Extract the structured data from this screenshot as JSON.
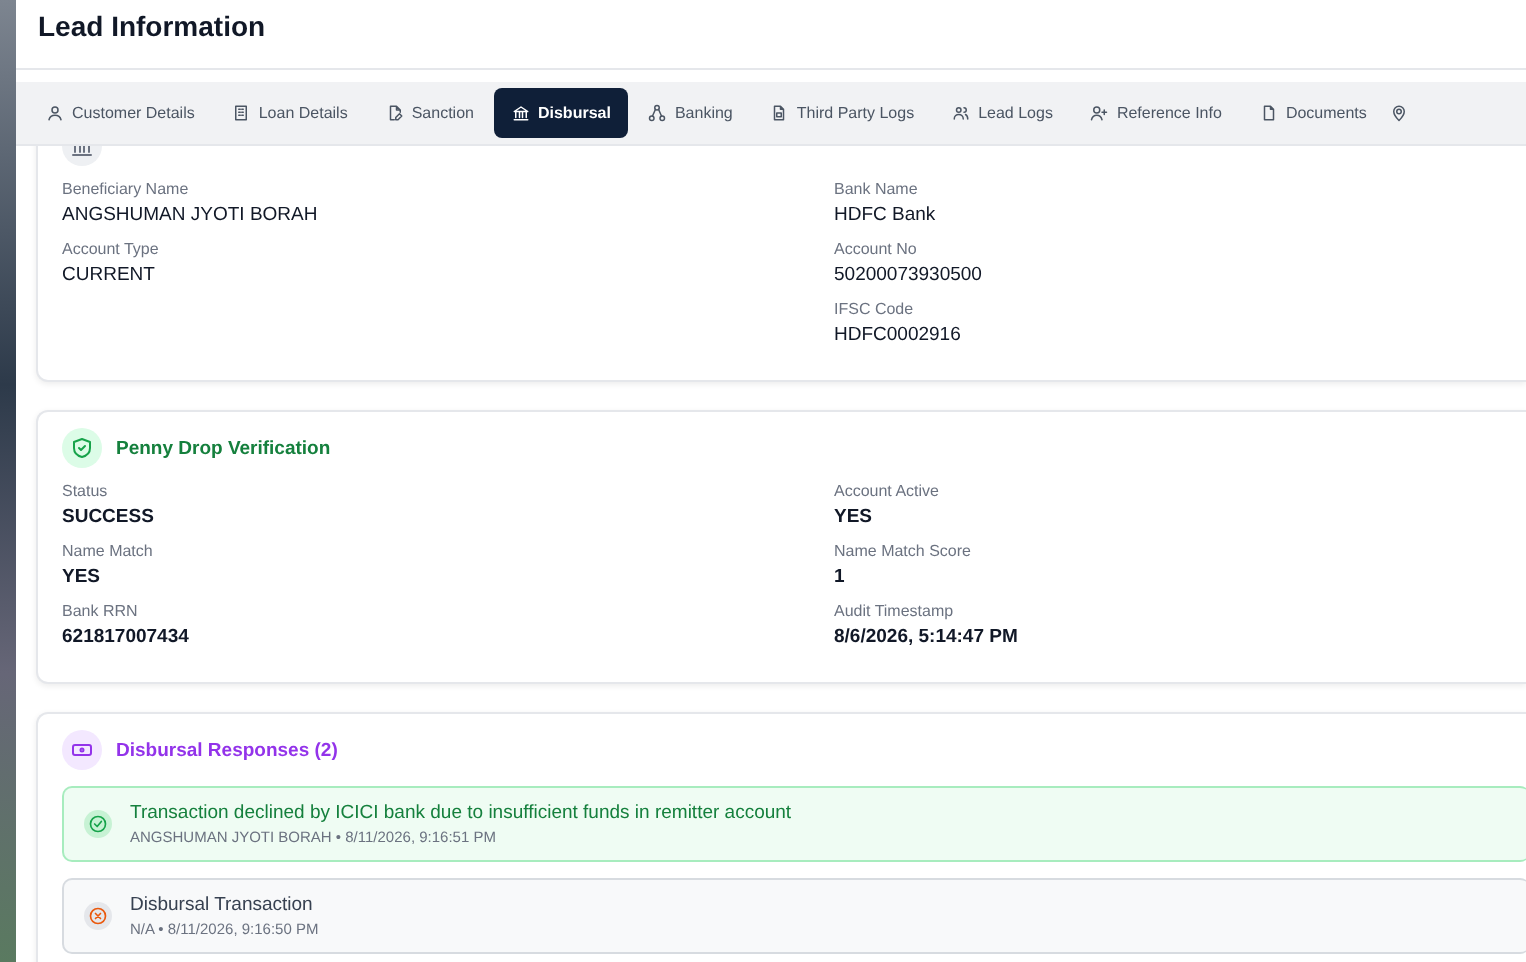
{
  "window": {
    "title": "Lead Information"
  },
  "tabs": [
    {
      "label": "Customer Details",
      "selected": false
    },
    {
      "label": "Loan Details",
      "selected": false
    },
    {
      "label": "Sanction",
      "selected": false
    },
    {
      "label": "Disbursal",
      "selected": true
    },
    {
      "label": "Banking",
      "selected": false
    },
    {
      "label": "Third Party Logs",
      "selected": false
    },
    {
      "label": "Lead Logs",
      "selected": false
    },
    {
      "label": "Reference Info",
      "selected": false
    },
    {
      "label": "Documents",
      "selected": false
    },
    {
      "selected": false
    }
  ],
  "sections": [
    {
      "kind": "details",
      "left": [
        {
          "label": "Beneficiary Name",
          "value": "ANGSHUMAN JYOTI BORAH"
        },
        {
          "label": "Account Type",
          "value": "CURRENT"
        }
      ],
      "right": [
        {
          "label": "Bank Name",
          "value": "HDFC Bank"
        },
        {
          "label": "Account No",
          "value": "50200073930500"
        },
        {
          "label": "IFSC Code",
          "value": "HDFC0002916"
        }
      ]
    },
    {
      "kind": "verification",
      "title": "Penny Drop Verification",
      "left": [
        {
          "label": "Status",
          "value": "SUCCESS"
        },
        {
          "label": "Name Match",
          "value": "YES"
        },
        {
          "label": "Bank RRN",
          "value": "621817007434"
        }
      ],
      "right": [
        {
          "label": "Account Active",
          "value": "YES"
        },
        {
          "label": "Name Match Score",
          "value": "1"
        },
        {
          "label": "Audit Timestamp",
          "value": "8/6/2026, 5:14:47 PM"
        }
      ]
    },
    {
      "kind": "responses",
      "title": "Disbursal Responses (2)",
      "items": [
        {
          "kind": "success",
          "message": "Transaction declined by ICICI bank due to insufficient funds in remitter account",
          "meta": "ANGSHUMAN JYOTI BORAH • 8/11/2026, 9:16:51 PM"
        },
        {
          "kind": "failure",
          "message": "Disbursal Transaction",
          "meta": "N/A • 8/11/2026, 9:16:50 PM"
        }
      ]
    }
  ]
}
